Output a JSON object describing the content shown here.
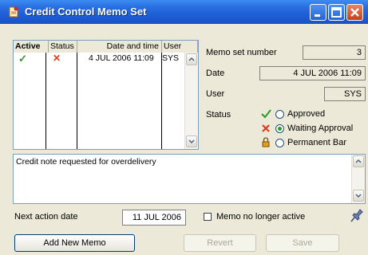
{
  "window": {
    "title": "Credit Control Memo Set"
  },
  "list": {
    "headers": {
      "active": "Active",
      "status": "Status",
      "datetime": "Date and time",
      "user": "User"
    },
    "rows": [
      {
        "active": "✓",
        "status": "✕",
        "datetime": "4 JUL 2006 11:09",
        "user": "SYS"
      }
    ]
  },
  "details": {
    "memo_set_number_label": "Memo set number",
    "memo_set_number": "3",
    "date_label": "Date",
    "date": "4 JUL 2006 11:09",
    "user_label": "User",
    "user": "SYS",
    "status_label": "Status",
    "status_options": [
      {
        "label": "Approved",
        "selected": false
      },
      {
        "label": "Waiting Approval",
        "selected": true
      },
      {
        "label": "Permanent Bar",
        "selected": false
      }
    ]
  },
  "memo": {
    "text": "Credit note requested for overdelivery"
  },
  "next_action": {
    "label": "Next action date",
    "date": "11 JUL 2006",
    "no_longer_active_label": "Memo no longer active",
    "no_longer_active_checked": false
  },
  "buttons": {
    "add_new_memo": "Add New Memo",
    "revert": "Revert",
    "save": "Save"
  },
  "colors": {
    "active_check": "#2a9a2a",
    "status_x": "#e03a1a",
    "accent": "#2563d8"
  },
  "icons": [
    "app-memo-icon",
    "minimize-icon",
    "maximize-icon",
    "close-icon",
    "check-icon",
    "x-icon",
    "lock-icon",
    "pin-icon"
  ]
}
